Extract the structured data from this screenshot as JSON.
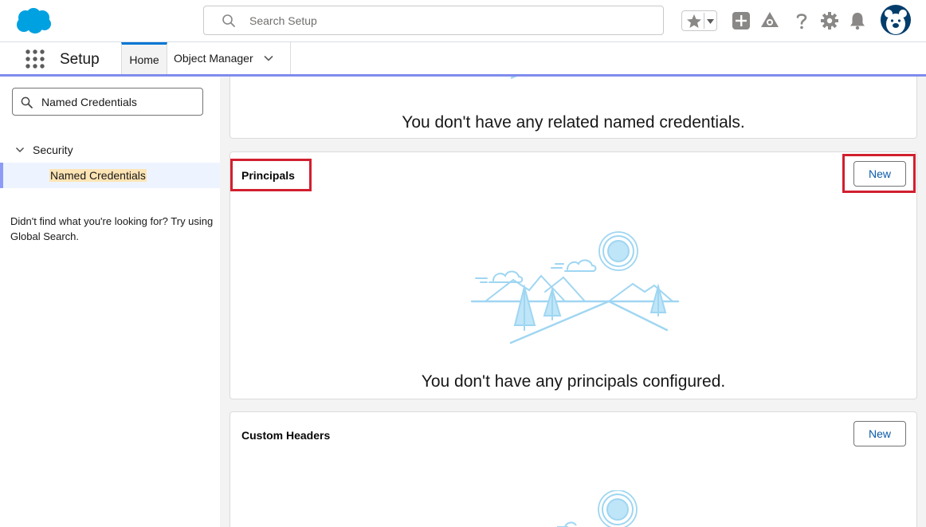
{
  "header": {
    "search_placeholder": "Search Setup",
    "icons": [
      "salesforce-cloud-logo",
      "star-icon",
      "chevron-down-icon",
      "plus-icon",
      "trailhead-icon",
      "help-icon",
      "gear-icon",
      "bell-icon",
      "avatar"
    ]
  },
  "nav": {
    "app_name": "Setup",
    "tabs": [
      {
        "label": "Home",
        "active": true
      },
      {
        "label": "Object Manager",
        "active": false
      }
    ]
  },
  "sidebar": {
    "quick_find_value": "Named Credentials",
    "tree": {
      "section_label": "Security",
      "item_label": "Named Credentials"
    },
    "help_text": "Didn't find what you're looking for? Try using Global Search."
  },
  "main": {
    "related_card": {
      "empty_message": "You don't have any related named credentials."
    },
    "principals_card": {
      "title": "Principals",
      "new_button": "New",
      "empty_message": "You don't have any principals configured."
    },
    "custom_headers_card": {
      "title": "Custom Headers",
      "new_button": "New"
    }
  },
  "colors": {
    "brand_blue": "#0176d3",
    "link_blue": "#0b5cab",
    "nav_underline": "#7f8ced",
    "highlight_red": "#d21f2f",
    "illustration_blue": "#9fd6f2"
  }
}
